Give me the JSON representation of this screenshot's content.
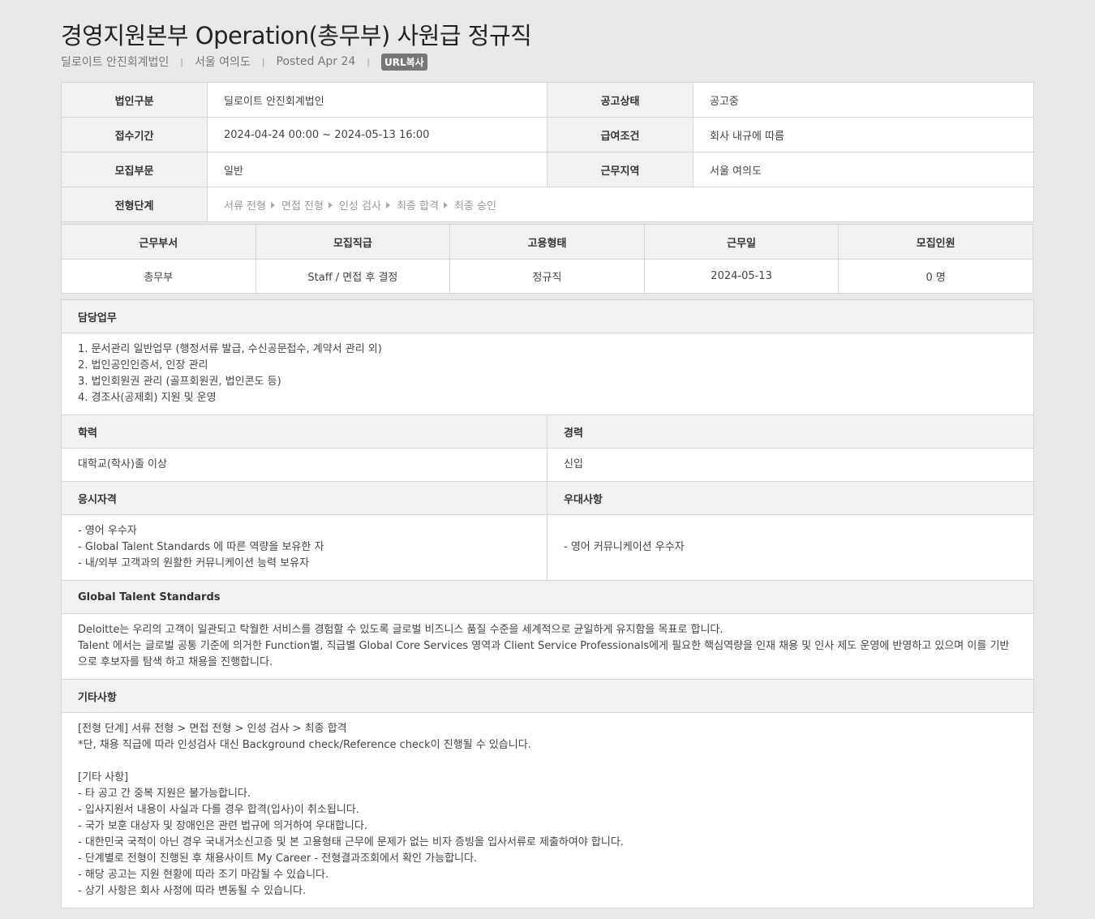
{
  "header": {
    "title": "경영지원본부 Operation(총무부) 사원급 정규직",
    "company": "딜로이트 안진회계법인",
    "location": "서울 여의도",
    "posted": "Posted Apr 24",
    "separator": "|",
    "copy_url_label": "URL복사"
  },
  "summary": {
    "entity_label": "법인구분",
    "entity_value": "딜로이트 안진회계법인",
    "status_label": "공고상태",
    "status_value": "공고중",
    "period_label": "접수기간",
    "period_value": "2024-04-24 00:00 ~ 2024-05-13 16:00",
    "salary_label": "급여조건",
    "salary_value": "회사 내규에 따름",
    "division_label": "모집부문",
    "division_value": "일반",
    "region_label": "근무지역",
    "region_value": "서울 여의도",
    "steps_label": "전형단계",
    "steps": [
      "서류 전형",
      "면접 전형",
      "인성 검사",
      "최종 합격",
      "최종 승인"
    ]
  },
  "positions": {
    "headers": [
      "근무부서",
      "모집직급",
      "고용형태",
      "근무일",
      "모집인원"
    ],
    "row": [
      "총무부",
      "Staff / 면접 후 결정",
      "정규직",
      "2024-05-13",
      "0 명"
    ]
  },
  "details": {
    "duties_title": "담당업무",
    "duties": [
      "1. 문서관리 일반업무 (행정서류 발급, 수신공문접수, 계약서 관리 외)",
      "2. 법인공인인증서, 인장 관리",
      "3. 법인회원권 관리 (골프회원권, 법인콘도 등)",
      "4. 경조사(공제회) 지원 및 운영"
    ],
    "education_title": "학력",
    "education": "대학교(학사)졸 이상",
    "experience_title": "경력",
    "experience": "신입",
    "qualification_title": "응시자격",
    "qualifications": [
      "- 영어 우수자",
      "- Global Talent Standards 에 따른 역량을 보유한 자",
      "- 내/외부 고객과의 원활한 커뮤니케이션 능력 보유자"
    ],
    "preference_title": "우대사항",
    "preference": "- 영어 커뮤니케이션 우수자",
    "gts_title": "Global Talent Standards",
    "gts_text": "Deloitte는 우리의 고객이 일관되고 탁월한 서비스를 경험할 수 있도록 글로벌 비즈니스 품질 수준을 세계적으로 균일하게 유지함을 목표로 합니다.",
    "gts_text2": "Talent 에서는 글로벌 공통 기준에 의거한 Function별, 직급별 Global Core Services 영역과 Client Service Professionals에게 필요한 핵심역량을 인재 채용 및 인사 제도 운영에 반영하고 있으며 이를 기반으로 후보자를 탐색 하고 채용을 진행합니다.",
    "misc_title": "기타사항",
    "misc_block1": [
      "[전형 단계] 서류 전형 > 면접 전형 > 인성 검사 > 최종 합격",
      "*단, 채용 직급에 따라 인성검사 대신 Background check/Reference check이 진행될 수 있습니다."
    ],
    "misc_block2": [
      "[기타 사항]",
      "- 타 공고 간 중복 지원은 불가능합니다.",
      "- 입사지원서 내용이 사실과 다를 경우 합격(입사)이 취소됩니다.",
      "- 국가 보훈 대상자 및 장애인은 관련 법규에 의거하여 우대합니다.",
      "- 대한민국 국적이 아닌 경우 국내거소신고증 및 본 고용형태 근무에 문제가 없는 비자 증빙을 입사서류로 제출하여야 합니다.",
      "- 단계별로 전형이 진행된 후 채용사이트 My Career - 전형결과조회에서 확인 가능합니다.",
      "- 해당 공고는 지원 현황에 따라 조기 마감될 수 있습니다.",
      "- 상기 사항은 회사 사정에 따라 변동될 수 있습니다."
    ]
  }
}
